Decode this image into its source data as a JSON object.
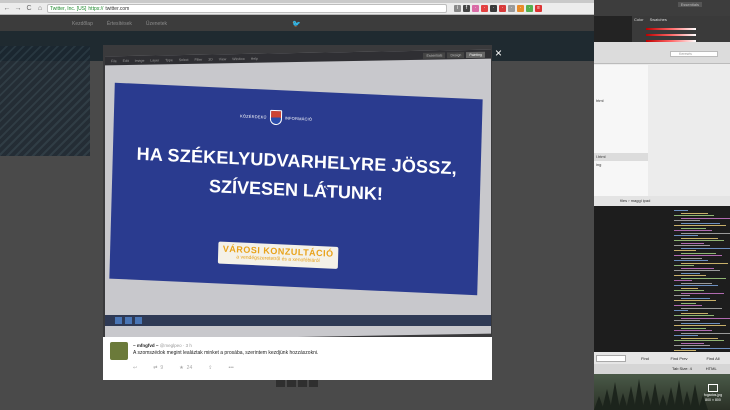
{
  "browser": {
    "url_ev": "Twitter, Inc. [US]",
    "url_prefix": "https://",
    "url_rest": "twitter.com",
    "nav_back": "←",
    "nav_forward": "→",
    "nav_reload": "C",
    "nav_home": "⌂",
    "extensions": [
      {
        "glyph": "i",
        "color": "#888888"
      },
      {
        "glyph": "f",
        "color": "#444444"
      },
      {
        "glyph": "·",
        "color": "#d96ba6"
      },
      {
        "glyph": "·",
        "color": "#e24040"
      },
      {
        "glyph": "·",
        "color": "#3a3a3a"
      },
      {
        "glyph": "·",
        "color": "#d83a3a"
      },
      {
        "glyph": "·",
        "color": "#9a9a9a"
      },
      {
        "glyph": "·",
        "color": "#e88b2a"
      },
      {
        "glyph": "·",
        "color": "#54b04f"
      },
      {
        "glyph": "≡",
        "color": "#d33"
      }
    ]
  },
  "twitter": {
    "nav": [
      "Kezdőlap",
      "Értesítések",
      "Üzenetek"
    ],
    "bird": "🐦"
  },
  "lightbox": {
    "close": "×",
    "photo": {
      "app_menu": [
        "File",
        "Edit",
        "Image",
        "Layer",
        "Type",
        "Select",
        "Filter",
        "3D",
        "View",
        "Window",
        "Help"
      ],
      "workspaces": [
        "Essentials",
        "Design",
        "Painting"
      ],
      "active_workspace": "Painting",
      "slide_header_left": "KÖZÉRDEKŰ",
      "slide_header_right": "INFORMÁCIÓ",
      "headline_line1": "HA SZÉKELYUDVARHELYRE JÖSSZ,",
      "headline_line2": "SZÍVESEN LÁTUNK!",
      "badge_line1": "VÁROSI KONZULTÁCIÓ",
      "badge_line2": "a vendégszeretetről és a xenofóbiáról"
    },
    "tweet": {
      "name": "~ mfngfvd ~",
      "handle": "@meglpeo",
      "time": "· 3 h",
      "text": "A szomszédok megint lealáztak minket a prosába, szerintem kezdjünk hozzászokni.",
      "reply_icon": "↩",
      "retweet_icon": "⇄",
      "retweet_count": "9",
      "like_icon": "★",
      "like_count": "24",
      "share_icon": "⇪",
      "more_icon": "•••"
    }
  },
  "ide": {
    "top_label": "Essentials",
    "ps_labels": [
      "Color",
      "Swatches"
    ],
    "finder_search": "Keresés",
    "finder_items": [
      "",
      "",
      "",
      "",
      "html",
      "",
      "",
      "",
      "",
      "",
      "",
      "l.html",
      "ing",
      "",
      ""
    ],
    "finder_selected": 11,
    "path_left": "files",
    "path_sep": "›",
    "path_right": "maggi ipad",
    "find_buttons": [
      "Find",
      "Find Prev",
      "Find All"
    ],
    "status_tab": "Tab Size: 4",
    "status_lang": "HTML",
    "desktop_file": "fogados.jpg",
    "desktop_file_size": "800 × 800"
  }
}
